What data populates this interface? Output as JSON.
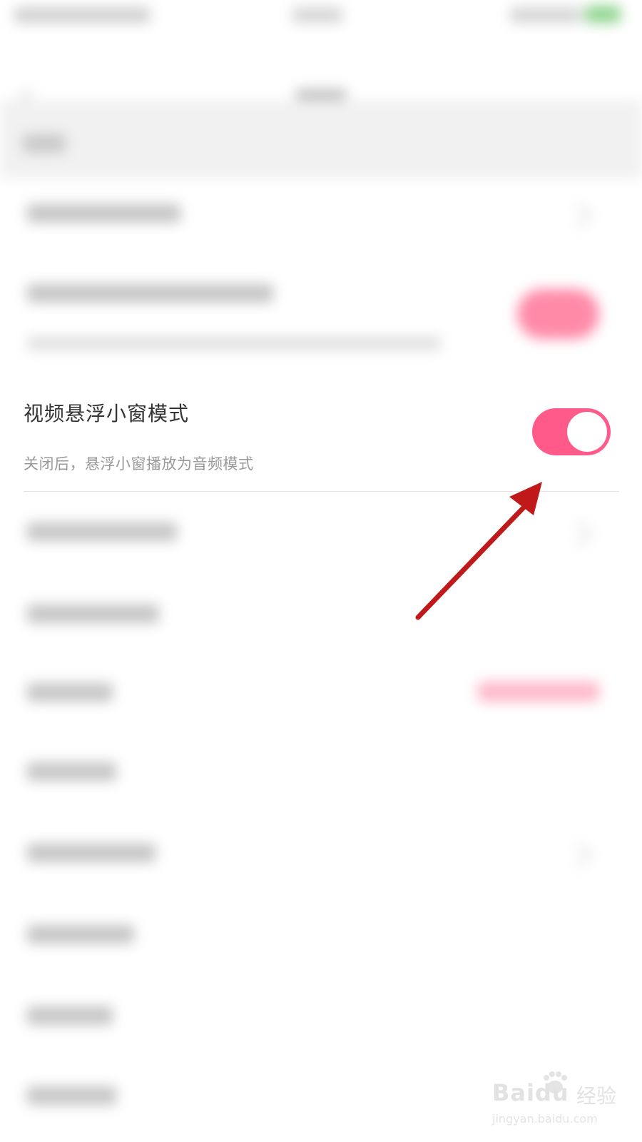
{
  "setting": {
    "title": "视频悬浮小窗模式",
    "description": "关闭后，悬浮小窗播放为音频模式",
    "toggle_on": true,
    "toggle_color": "#ff5a8a"
  },
  "annotation": {
    "arrow_color": "#c0191a",
    "arrow_icon": "arrow-pointer-icon"
  },
  "watermark": {
    "brand": "Baidu",
    "brand_suffix": "经验",
    "url": "jingyan.baidu.com"
  }
}
